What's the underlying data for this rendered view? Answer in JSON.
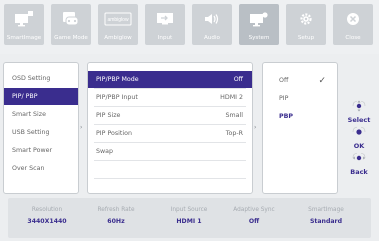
{
  "top_tabs": [
    {
      "label": "SmartImage",
      "icon": "smartimage-icon"
    },
    {
      "label": "Game Mode",
      "icon": "gamepad-icon"
    },
    {
      "label": "Ambiglow",
      "icon": "ambiglow-icon"
    },
    {
      "label": "Input",
      "icon": "input-icon"
    },
    {
      "label": "Audio",
      "icon": "speaker-icon"
    },
    {
      "label": "System",
      "icon": "system-icon"
    },
    {
      "label": "Setup",
      "icon": "gear-icon"
    },
    {
      "label": "Close",
      "icon": "close-icon"
    }
  ],
  "ambiglow_logo_text": "ambiglow",
  "system_menu": [
    "OSD Setting",
    "PIP/ PBP",
    "Smart Size",
    "USB Setting",
    "Smart Power",
    "Over Scan"
  ],
  "pip_settings": [
    {
      "label": "PIP/PBP Mode",
      "value": "Off"
    },
    {
      "label": "PIP/PBP Input",
      "value": "HDMI 2"
    },
    {
      "label": "PIP Size",
      "value": "Small"
    },
    {
      "label": "PIP Position",
      "value": "Top-R"
    },
    {
      "label": "Swap",
      "value": ""
    }
  ],
  "mode_options": [
    {
      "label": "Off",
      "checked": true
    },
    {
      "label": "PIP",
      "checked": false
    },
    {
      "label": "PBP",
      "checked": false
    }
  ],
  "controls": [
    {
      "label": "Select",
      "icon": "select-joystick-icon"
    },
    {
      "label": "OK",
      "icon": "ok-joystick-icon"
    },
    {
      "label": "Back",
      "icon": "back-joystick-icon"
    }
  ],
  "status": [
    {
      "key": "Resolution",
      "value": "3440X1440"
    },
    {
      "key": "Refresh Rate",
      "value": "60Hz"
    },
    {
      "key": "Input Source",
      "value": "HDMI 1"
    },
    {
      "key": "Adaptive Sync",
      "value": "Off"
    },
    {
      "key": "SmartImage",
      "value": "Standard"
    }
  ],
  "colors": {
    "accent": "#3a2d8e",
    "tab": "#ced2d6",
    "tab_active": "#b9bfc5"
  },
  "checkmark": "✓"
}
